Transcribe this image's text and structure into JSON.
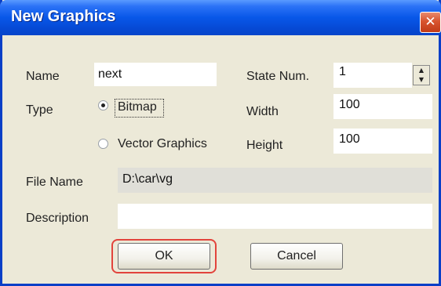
{
  "window": {
    "title": "New Graphics",
    "close_glyph": "✕",
    "close_icon": "close-icon"
  },
  "form": {
    "name_label": "Name",
    "name_value": "next",
    "state_num_label": "State Num.",
    "state_num_value": "1",
    "spin_up_glyph": "▲",
    "spin_down_glyph": "▼",
    "type_label": "Type",
    "type_options": [
      {
        "label": "Bitmap",
        "selected": true
      },
      {
        "label": "Vector Graphics",
        "selected": false
      }
    ],
    "width_label": "Width",
    "width_value": "100",
    "height_label": "Height",
    "height_value": "100",
    "file_name_label": "File Name",
    "file_name_value": "D:\\car\\vg",
    "description_label": "Description",
    "description_value": ""
  },
  "buttons": {
    "ok_label": "OK",
    "cancel_label": "Cancel"
  },
  "colors": {
    "titlebar": "#0857e8",
    "dialog_bg": "#ece9d8",
    "close_button": "#d8542f",
    "ok_highlight": "#e2443c"
  }
}
